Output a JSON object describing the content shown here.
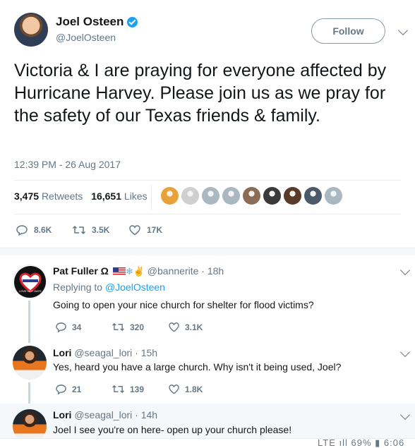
{
  "tweet": {
    "author_name": "Joel Osteen",
    "author_handle": "@JoelOsteen",
    "follow_label": "Follow",
    "text": "Victoria & I are praying for everyone affected by Hurricane Harvey. Please join us as we pray for the safety of our Texas friends & family.",
    "timestamp": "12:39 PM - 26 Aug 2017",
    "retweets_count": "3,475",
    "retweets_label": "Retweets",
    "likes_count": "16,651",
    "likes_label": "Likes",
    "actions": {
      "replies": "8.6K",
      "retweets": "3.5K",
      "likes": "17K"
    },
    "likers_colors": [
      "#e9a23b",
      "#cfcfcf",
      "#aab8c2",
      "#aab8c2",
      "#8a6d57",
      "#3a3a3a",
      "#5a3b2a",
      "#4a5a6a",
      "#aab8c2"
    ]
  },
  "replies": [
    {
      "name": "Pat Fuller Ω",
      "handle": "@bannerite",
      "time": "· 18h",
      "replying_prefix": "Replying to",
      "replying_to": "@JoelOsteen",
      "text": "Going to open your nice church for shelter for flood victims?",
      "replies": "34",
      "retweets": "320",
      "likes": "3.1K",
      "avatar_caption": "LOVE NOT HATE"
    },
    {
      "name": "Lori",
      "handle": "@seagal_lori",
      "time": "· 15h",
      "text": "Yes, heard you have a large church. Why isn't it being used, Joel?",
      "replies": "21",
      "retweets": "139",
      "likes": "1.8K"
    },
    {
      "name": "Lori",
      "handle": "@seagal_lori",
      "time": "· 14h",
      "text": "Joel I see you're on here- open up your church please!"
    }
  ],
  "status_bar": {
    "text": "LTE ıll 69% ▮ 6:06 AM"
  },
  "colors": {
    "accent": "#1da1f2",
    "muted": "#657786",
    "text": "#14171a",
    "border": "#e6ecf0"
  }
}
